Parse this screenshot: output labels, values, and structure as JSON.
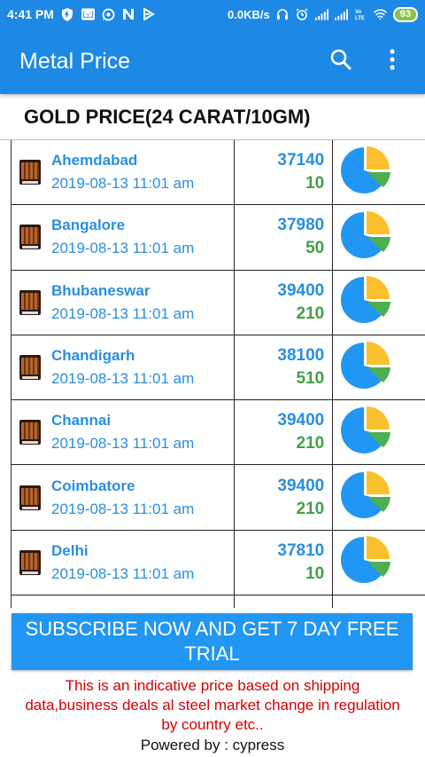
{
  "status_bar": {
    "time": "4:41 PM",
    "network_speed": "0.0KB/s",
    "battery": "93",
    "icons": [
      "shield-icon",
      "mail-icon",
      "whatsapp-icon",
      "n-icon",
      "play-icon",
      "headphones-icon",
      "alarm-icon",
      "signal-icon",
      "signal-icon",
      "volte-icon",
      "wifi-icon"
    ]
  },
  "app_bar": {
    "title": "Metal Price",
    "search_icon": "search-icon",
    "menu_icon": "more-vert-icon"
  },
  "section_title": "GOLD PRICE(24 CARAT/10GM)",
  "rows": [
    {
      "city": "Ahemdabad",
      "date": "2019-08-13 11:01 am",
      "price": "37140",
      "change": "10"
    },
    {
      "city": "Bangalore",
      "date": "2019-08-13 11:01 am",
      "price": "37980",
      "change": "50"
    },
    {
      "city": "Bhubaneswar",
      "date": "2019-08-13 11:01 am",
      "price": "39400",
      "change": "210"
    },
    {
      "city": "Chandigarh",
      "date": "2019-08-13 11:01 am",
      "price": "38100",
      "change": "510"
    },
    {
      "city": "Channai",
      "date": "2019-08-13 11:01 am",
      "price": "39400",
      "change": "210"
    },
    {
      "city": "Coimbatore",
      "date": "2019-08-13 11:01 am",
      "price": "39400",
      "change": "210"
    },
    {
      "city": "Delhi",
      "date": "2019-08-13 11:01 am",
      "price": "37810",
      "change": "10"
    },
    {
      "city": "",
      "date": "",
      "price": "",
      "change": ""
    }
  ],
  "colors": {
    "primary": "#1e88e5",
    "text_blue": "#2a8ee0",
    "green": "#43a047",
    "pie_blue": "#2196f3",
    "pie_yellow": "#fbc02d",
    "pie_green": "#4caf50",
    "disclaimer_red": "#d50000"
  },
  "subscribe_label": "SUBSCRIBE NOW AND GET 7 DAY FREE TRIAL",
  "disclaimer": "This is an indicative price based on shipping data,business deals al steel market change in regulation by country etc..",
  "powered_by": "Powered by : cypress"
}
